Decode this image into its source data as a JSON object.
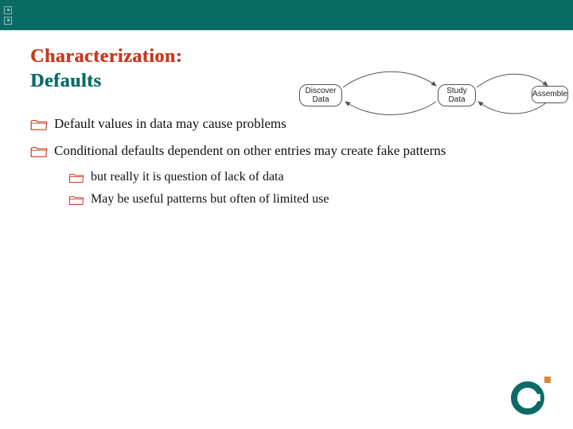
{
  "title": {
    "line1": "Characterization:",
    "line2": "Defaults"
  },
  "bullets": {
    "item1": "Default values in data may cause problems",
    "item2": "Conditional defaults dependent on other entries may create fake patterns",
    "sub1": "but really it is question of lack of data",
    "sub2": "May be useful patterns but often of limited use"
  },
  "diagram": {
    "node1": "Discover Data",
    "node2": "Study Data",
    "node3": "Assemble"
  },
  "colors": {
    "teal": "#0a6b66",
    "red": "#c73a1e",
    "orange": "#d88a3a"
  }
}
